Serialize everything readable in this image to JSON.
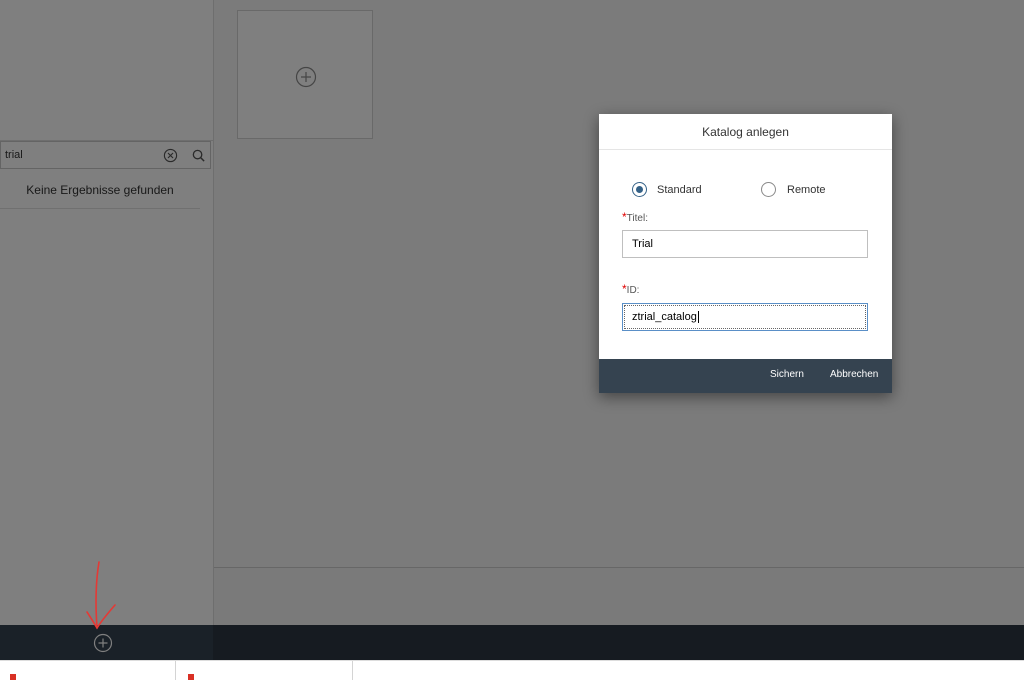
{
  "sidebar": {
    "search": {
      "value": "trial"
    },
    "no_results": "Keine Ergebnisse gefunden"
  },
  "dialog": {
    "title": "Katalog anlegen",
    "radio_options": [
      {
        "label": "Standard",
        "checked": true
      },
      {
        "label": "Remote",
        "checked": false
      }
    ],
    "title_field": {
      "required_mark": "*",
      "label": "Titel:",
      "value": "Trial"
    },
    "id_field": {
      "required_mark": "*",
      "label": "ID:",
      "value": "ztrial_catalog"
    },
    "buttons": {
      "save": "Sichern",
      "cancel": "Abbrechen"
    }
  },
  "colors": {
    "footer": "#354350",
    "accent": "#346187",
    "required": "#e00000",
    "annotation": "#e53935"
  },
  "icons": [
    "clear-icon",
    "search-icon",
    "plus-circle-icon",
    "add-icon",
    "annotation-arrow",
    "document-icon"
  ]
}
